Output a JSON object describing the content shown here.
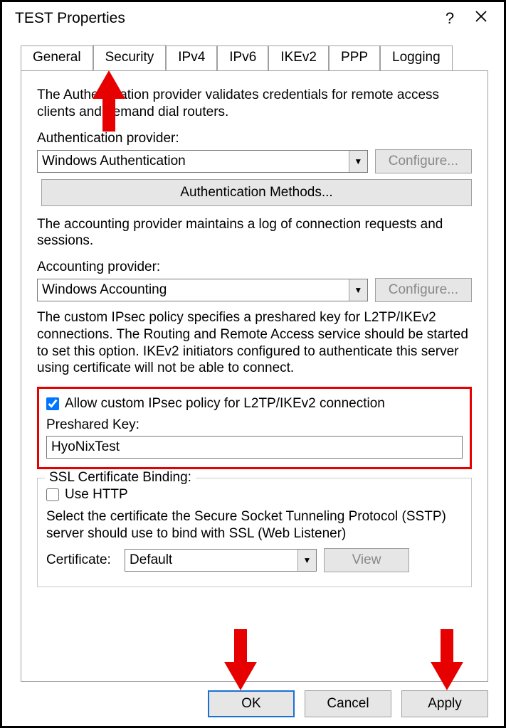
{
  "window": {
    "title": "TEST Properties"
  },
  "tabs": [
    "General",
    "Security",
    "IPv4",
    "IPv6",
    "IKEv2",
    "PPP",
    "Logging"
  ],
  "active_tab": 1,
  "auth": {
    "desc": "The Authentication provider validates credentials for remote access clients and demand dial routers.",
    "provider_label": "Authentication provider:",
    "provider_value": "Windows Authentication",
    "configure": "Configure...",
    "methods": "Authentication Methods..."
  },
  "acct": {
    "desc": "The accounting provider maintains a log of connection requests and sessions.",
    "provider_label": "Accounting provider:",
    "provider_value": "Windows Accounting",
    "configure": "Configure..."
  },
  "ipsec": {
    "desc": "The custom IPsec policy specifies a preshared key for L2TP/IKEv2 connections. The Routing and Remote Access service should be started to set this option. IKEv2 initiators configured to authenticate this server using certificate will not be able to connect.",
    "allow_label": "Allow custom IPsec policy for L2TP/IKEv2 connection",
    "allow_checked": true,
    "psk_label": "Preshared Key:",
    "psk_value": "HyoNixTest"
  },
  "ssl": {
    "legend": "SSL Certificate Binding:",
    "usehttp_label": "Use HTTP",
    "usehttp_checked": false,
    "desc": "Select the certificate the Secure Socket Tunneling Protocol (SSTP) server should use to bind with SSL (Web Listener)",
    "cert_label": "Certificate:",
    "cert_value": "Default",
    "view": "View"
  },
  "buttons": {
    "ok": "OK",
    "cancel": "Cancel",
    "apply": "Apply"
  }
}
